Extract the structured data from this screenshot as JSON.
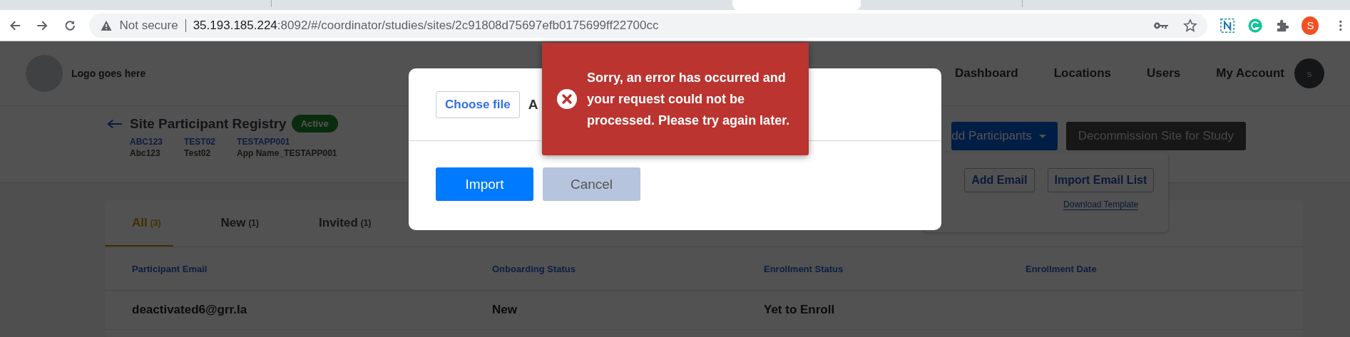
{
  "browser_tabs": [
    {
      "selected": false
    },
    {
      "selected": true
    },
    {
      "selected": false
    }
  ],
  "browser": {
    "security": "Not secure",
    "host": "35.193.185.224",
    "path": ":8092/#/coordinator/studies/sites/2c91808d75697efb0175699ff22700cc",
    "profile_initial": "S"
  },
  "header": {
    "logo_text": "Logo goes here",
    "nav": [
      {
        "label": "Dashboard"
      },
      {
        "label": "Locations"
      },
      {
        "label": "Users"
      },
      {
        "label": "My Account"
      }
    ],
    "avatar_initial": "s"
  },
  "site": {
    "title": "Site Participant Registry",
    "status": "Active",
    "meta": [
      {
        "code": "ABC123",
        "name": "Abc123"
      },
      {
        "code": "TEST02",
        "name": "Test02"
      },
      {
        "code": "TESTAPP001",
        "name": "App Name_TESTAPP001"
      }
    ],
    "add_button": "dd Participants",
    "decommission_button": "Decommission Site for Study"
  },
  "add_menu": {
    "buttons": [
      "Add Email",
      "Import Email List"
    ],
    "link": "Download Template"
  },
  "tabs": [
    {
      "label": "All",
      "count": "(3)",
      "selected": true
    },
    {
      "label": "New",
      "count": "(1)",
      "selected": false
    },
    {
      "label": "Invited",
      "count": "(1)",
      "selected": false
    }
  ],
  "table": {
    "columns": [
      "Participant Email",
      "Onboarding Status",
      "Enrollment Status",
      "Enrollment Date"
    ],
    "rows": [
      [
        "deactivated6@grr.la",
        "New",
        "Yet to Enroll"
      ]
    ]
  },
  "modal": {
    "choose_file": "Choose file",
    "file_label": "A",
    "buttons": [
      {
        "label": "Import",
        "kind": "primary"
      },
      {
        "label": "Cancel",
        "kind": "secondary"
      }
    ]
  },
  "toast": {
    "kind": "error",
    "message": "Sorry, an error has occurred and your request could not be processed. Please try again later."
  }
}
